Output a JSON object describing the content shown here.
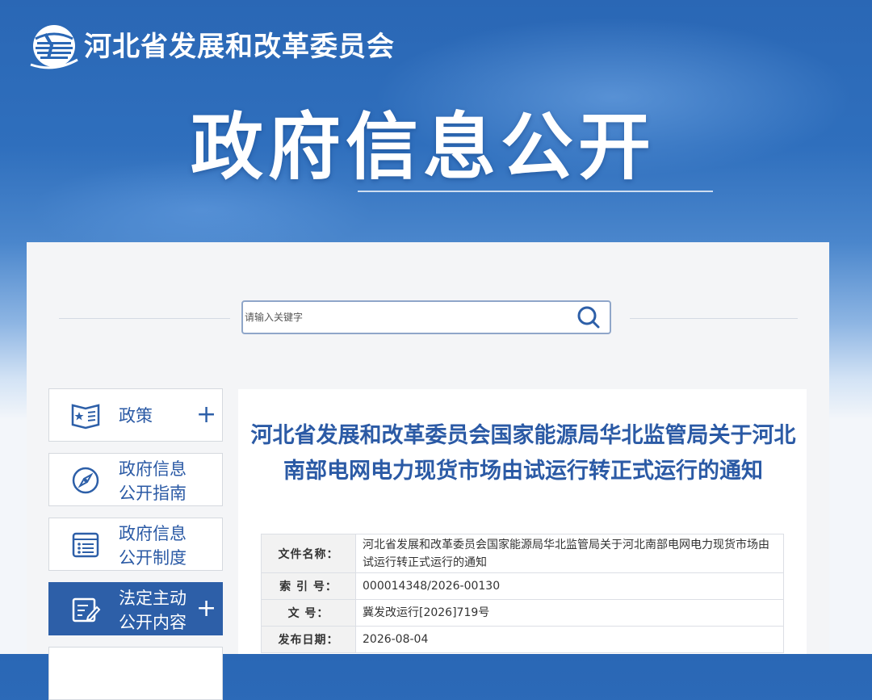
{
  "header": {
    "site_title": "河北省发展和改革委员会",
    "banner_title": "政府信息公开"
  },
  "search": {
    "placeholder": "请输入关键字",
    "value": ""
  },
  "sidebar": {
    "items": [
      {
        "label": "政策",
        "icon": "document-star-icon",
        "expandable": true,
        "active": false
      },
      {
        "label": "政府信息\n公开指南",
        "icon": "compass-icon",
        "expandable": false,
        "active": false
      },
      {
        "label": "政府信息\n公开制度",
        "icon": "list-icon",
        "expandable": false,
        "active": false
      },
      {
        "label": "法定主动\n公开内容",
        "icon": "edit-icon",
        "expandable": true,
        "active": true
      }
    ]
  },
  "document": {
    "title": "河北省发展和改革委员会国家能源局华北监管局关于河北南部电网电力现货市场由试运行转正式运行的通知",
    "meta": [
      {
        "key": "文件名称：",
        "value": "河北省发展和改革委员会国家能源局华北监管局关于河北南部电网电力现货市场由试运行转正式运行的通知"
      },
      {
        "key": "索 引 号：",
        "value": "000014348/2026-00130"
      },
      {
        "key": "文     号：",
        "value": "冀发改运行[2026]719号"
      },
      {
        "key": "发布日期：",
        "value": "2026-08-04"
      }
    ]
  },
  "colors": {
    "brand_blue": "#2b5aa5",
    "active_bg": "#2d5fa8"
  }
}
